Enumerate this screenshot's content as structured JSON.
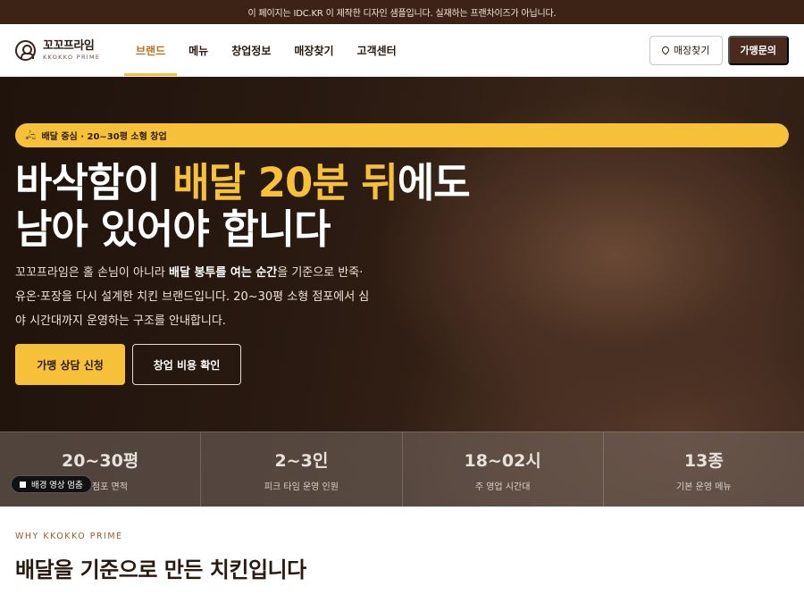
{
  "notice": "이 페이지는 IDC.KR 이 제작한 디자인 샘플입니다. 실재하는 프랜차이즈가 아닙니다.",
  "brand": {
    "name_ko": "꼬꼬프라임",
    "name_en": "KKOKKO PRIME",
    "logo_icon": "person-circle-icon"
  },
  "nav": {
    "items": [
      {
        "label": "브랜드",
        "active": true
      },
      {
        "label": "메뉴",
        "active": false
      },
      {
        "label": "창업정보",
        "active": false
      },
      {
        "label": "매장찾기",
        "active": false
      },
      {
        "label": "고객센터",
        "active": false
      }
    ],
    "find_store": "매장찾기",
    "inquiry": "가맹문의"
  },
  "hero": {
    "tag": "배달 중심 · 20~30평 소형 창업",
    "tag_icon": "scooter-icon",
    "headline_a": "바삭함이 ",
    "headline_hl": "배달 20분 뒤",
    "headline_b": "에도",
    "headline_line2": "남아 있어야 합니다",
    "desc_1": "꼬꼬프라임은 홀 손님이 아니라 ",
    "desc_bold": "배달 봉투를 여는 순간",
    "desc_2": "을 기준으로 반죽·유온·포장을 다시 설계한 치킨 브랜드입니다. 20~30평 소형 점포에서 심야 시간대까지 운영하는 구조를 안내합니다.",
    "cta_primary": "가맹 상담 신청",
    "cta_secondary": "창업 비용 확인",
    "pause_label": "배경 영상 멈춤"
  },
  "stats": [
    {
      "value": "20~30평",
      "label": "기준 점포 면적"
    },
    {
      "value": "2~3인",
      "label": "피크 타임 운영 인원"
    },
    {
      "value": "18~02시",
      "label": "주 영업 시간대"
    },
    {
      "value": "13종",
      "label": "기본 운영 메뉴"
    }
  ],
  "why": {
    "kicker": "WHY KKOKKO PRIME",
    "title": "배달을 기준으로 만든 치킨입니다"
  },
  "colors": {
    "accent": "#f6c138",
    "dark": "#3d2216",
    "brand_text": "#2b1a10"
  }
}
